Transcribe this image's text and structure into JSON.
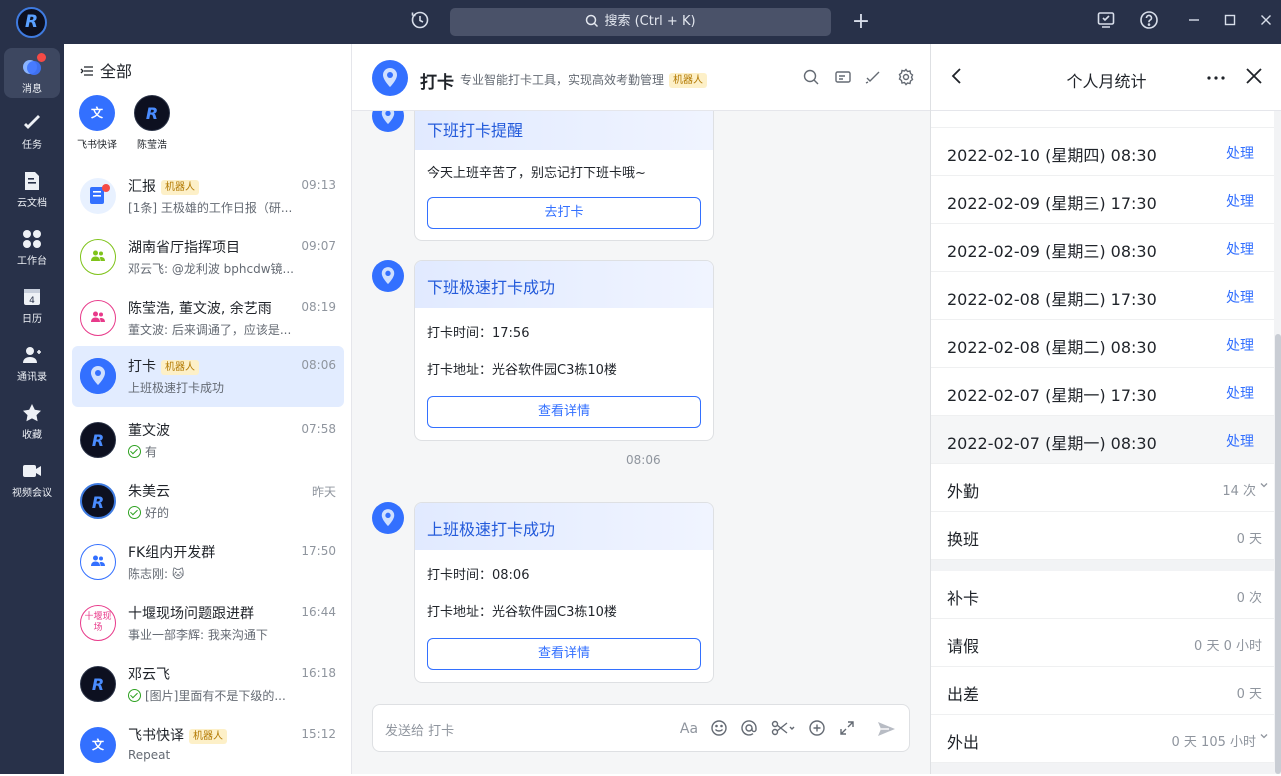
{
  "titlebar": {
    "logo": "R",
    "search_placeholder": "搜索 (Ctrl + K)"
  },
  "nav": [
    {
      "label": "消息",
      "icon": "message-icon"
    },
    {
      "label": "任务",
      "icon": "task-icon"
    },
    {
      "label": "云文档",
      "icon": "doc-icon"
    },
    {
      "label": "工作台",
      "icon": "workbench-icon"
    },
    {
      "label": "日历",
      "icon": "calendar-icon"
    },
    {
      "label": "通讯录",
      "icon": "contacts-icon"
    },
    {
      "label": "收藏",
      "icon": "star-icon"
    },
    {
      "label": "视频会议",
      "icon": "video-icon"
    }
  ],
  "calendar_day": "4",
  "list": {
    "header": "全部",
    "pinned": [
      {
        "name": "飞书快译",
        "avatar": "文"
      },
      {
        "name": "陈莹浩",
        "avatar": "R"
      }
    ],
    "conversations": [
      {
        "name": "汇报",
        "badge": "机器人",
        "time": "09:13",
        "preview": "[1条] 王极雄的工作日报（研..."
      },
      {
        "name": "湖南省厅指挥项目",
        "badge": "",
        "time": "09:07",
        "preview": "邓云飞: @龙利波 bphcdw镜..."
      },
      {
        "name": "陈莹浩, 董文波, 余艺雨",
        "badge": "",
        "time": "08:19",
        "preview": "董文波: 后来调通了，应该是..."
      },
      {
        "name": "打卡",
        "badge": "机器人",
        "time": "08:06",
        "preview": "上班极速打卡成功"
      },
      {
        "name": "董文波",
        "badge": "",
        "time": "07:58",
        "preview": "有"
      },
      {
        "name": "朱美云",
        "badge": "",
        "time": "昨天",
        "preview": "好的"
      },
      {
        "name": "FK组内开发群",
        "badge": "",
        "time": "17:50",
        "preview": "陈志刚: 🐱"
      },
      {
        "name": "十堰现场问题跟进群",
        "badge": "",
        "time": "16:44",
        "preview": "事业一部李辉: 我来沟通下",
        "avatar_text": "十堰现场"
      },
      {
        "name": "邓云飞",
        "badge": "",
        "time": "16:18",
        "preview": "[图片]里面有不是下级的..."
      },
      {
        "name": "飞书快译",
        "badge": "机器人",
        "time": "15:12",
        "preview": "Repeat"
      }
    ]
  },
  "chat": {
    "title": "打卡",
    "subtitle": "专业智能打卡工具，实现高效考勤管理",
    "badge": "机器人",
    "cards": [
      {
        "title": "下班打卡提醒",
        "lines": [
          "今天上班辛苦了，别忘记打下班卡哦~"
        ],
        "button": "去打卡"
      },
      {
        "title": "下班极速打卡成功",
        "lines": [
          "打卡时间：17:56",
          "打卡地址：光谷软件园C3栋10楼"
        ],
        "button": "查看详情"
      },
      {
        "title": "上班极速打卡成功",
        "lines": [
          "打卡时间：08:06",
          "打卡地址：光谷软件园C3栋10楼"
        ],
        "button": "查看详情"
      }
    ],
    "time_divider": "08:06",
    "input_placeholder": "发送给 打卡",
    "font_button": "Aa"
  },
  "panel": {
    "title": "个人月统计",
    "records": [
      {
        "datetime": "2022-02-10 (星期四) 08:30",
        "action": "处理"
      },
      {
        "datetime": "2022-02-09 (星期三) 17:30",
        "action": "处理"
      },
      {
        "datetime": "2022-02-09 (星期三) 08:30",
        "action": "处理"
      },
      {
        "datetime": "2022-02-08 (星期二) 17:30",
        "action": "处理"
      },
      {
        "datetime": "2022-02-08 (星期二) 08:30",
        "action": "处理"
      },
      {
        "datetime": "2022-02-07 (星期一) 17:30",
        "action": "处理"
      },
      {
        "datetime": "2022-02-07 (星期一) 08:30",
        "action": "处理"
      }
    ],
    "stats_a": [
      {
        "label": "外勤",
        "value": "14 次",
        "expand": true
      },
      {
        "label": "换班",
        "value": "0 天",
        "expand": false
      }
    ],
    "stats_b": [
      {
        "label": "补卡",
        "value": "0 次",
        "expand": false
      },
      {
        "label": "请假",
        "value": "0 天 0 小时",
        "expand": false
      },
      {
        "label": "出差",
        "value": "0 天",
        "expand": false
      },
      {
        "label": "外出",
        "value": "0 天 105 小时",
        "expand": true
      }
    ]
  }
}
